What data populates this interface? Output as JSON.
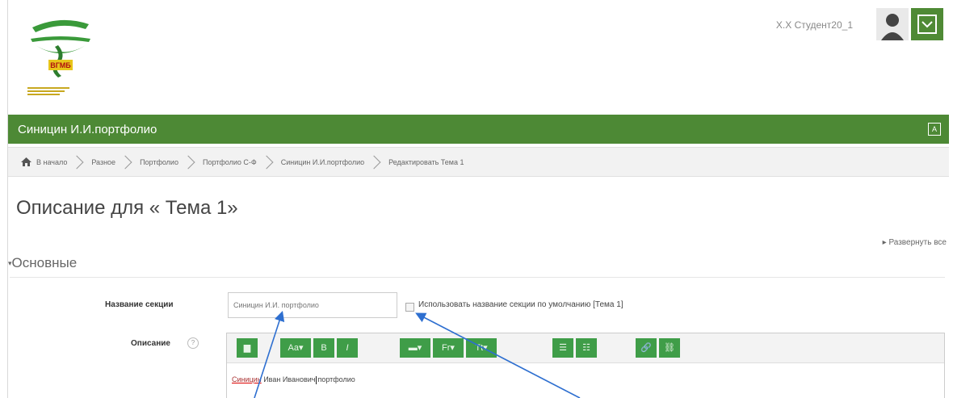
{
  "header": {
    "user_name": "Х.Х Студент20_1",
    "icons": {
      "avatar": "user-avatar",
      "menu": "dropdown-icon"
    }
  },
  "navbar": {
    "title": "Синицин И.И.портфолио",
    "language_icon": "language-icon"
  },
  "breadcrumb": {
    "home_icon": "home-icon",
    "items": [
      "В начало",
      "Разное",
      "Портфолио",
      "Портфолио С-Ф",
      "Синицин И.И.портфолио",
      "Редактировать Тема 1"
    ]
  },
  "page": {
    "title": "Описание для « Тема 1»",
    "expand_all": "▸ Развернуть все",
    "section": "Основные"
  },
  "form": {
    "section_name_label": "Название секции",
    "section_name_value": "Синицин И.И. портфолио",
    "use_default_label": "Использовать название секции по умолчанию [Тема 1]",
    "use_default_checked": false,
    "description_label": "Описание",
    "description_text_misspelled": "Синицин",
    "description_text_rest_a": "Иван Иванович",
    "description_text_rest_b": "портфолио"
  },
  "toolbar": {
    "buttons": [
      {
        "label": "▆",
        "icon": "show-more-icon"
      },
      {
        "label": "Aa▾",
        "icon": "paragraph-style-icon"
      },
      {
        "label": "B",
        "icon": "bold-icon"
      },
      {
        "label": "I",
        "icon": "italic-icon"
      },
      {
        "label": "▬▾",
        "icon": "highlight-icon"
      },
      {
        "label": "Fr▾",
        "icon": "font-icon"
      },
      {
        "label": "Tt▾",
        "icon": "text-style-icon"
      },
      {
        "label": "☰",
        "icon": "unordered-list-icon"
      },
      {
        "label": "☷",
        "icon": "ordered-list-icon"
      },
      {
        "label": "🔗",
        "icon": "link-icon"
      },
      {
        "label": "⛓",
        "icon": "unlink-icon"
      }
    ]
  },
  "colors": {
    "accent": "#4d8935",
    "button": "#3f9d48",
    "annotation_arrow": "#2e6fd0"
  }
}
